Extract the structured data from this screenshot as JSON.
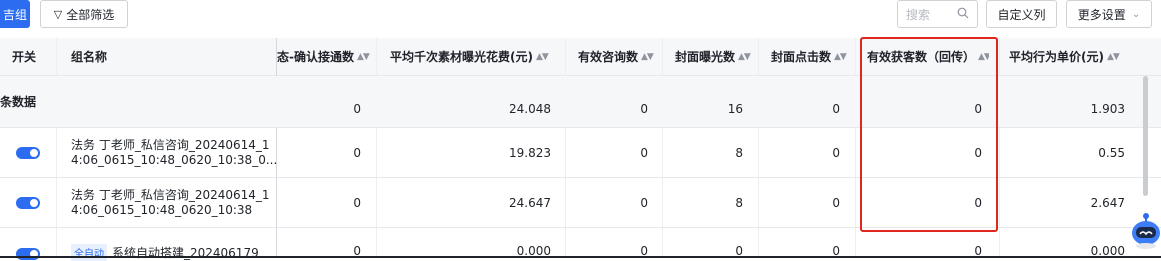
{
  "toolbar": {
    "primary_button_label": "吉组",
    "filter_label": "全部筛选",
    "search_placeholder": "搜索",
    "custom_columns_label": "自定义列",
    "more_settings_label": "更多设置"
  },
  "table": {
    "headers": {
      "switch": "开关",
      "group_name": "组名称",
      "confirmed_calls": "态-确认接通数",
      "cpm_cost": "平均千次素材曝光花费(元)",
      "valid_consult": "有效咨询数",
      "cover_impressions": "封面曝光数",
      "cover_clicks": "封面点击数",
      "valid_leads": "有效获客数（回传）",
      "avg_action_price": "平均行为单价(元)"
    },
    "summary": {
      "label": "条数据",
      "confirmed_calls": "0",
      "cpm_cost": "24.048",
      "valid_consult": "0",
      "cover_impressions": "16",
      "cover_clicks": "0",
      "valid_leads": "0",
      "avg_action_price": "1.903"
    },
    "rows": [
      {
        "name": "法务 丁老师_私信咨询_20240614_14:06_0615_10:48_0620_10:38_0...",
        "name_line1": "法务 丁老师_私信咨询_20240614_1",
        "name_line2": "4:06_0615_10:48_0620_10:38_0...",
        "confirmed_calls": "0",
        "cpm_cost": "19.823",
        "valid_consult": "0",
        "cover_impressions": "8",
        "cover_clicks": "0",
        "valid_leads": "0",
        "avg_action_price": "0.55"
      },
      {
        "name": "法务 丁老师_私信咨询_20240614_14:06_0615_10:48_0620_10:38",
        "name_line1": "法务 丁老师_私信咨询_20240614_1",
        "name_line2": "4:06_0615_10:48_0620_10:38",
        "confirmed_calls": "0",
        "cpm_cost": "24.647",
        "valid_consult": "0",
        "cover_impressions": "8",
        "cover_clicks": "0",
        "valid_leads": "0",
        "avg_action_price": "2.647"
      },
      {
        "tag": "全自动",
        "name_line1": "系统自动搭建_202406179",
        "confirmed_calls": "0",
        "cpm_cost": "0.000",
        "valid_consult": "0",
        "cover_impressions": "0",
        "cover_clicks": "0",
        "valid_leads": "0",
        "avg_action_price": "0.000"
      }
    ]
  },
  "colors": {
    "accent": "#2b6cf0",
    "highlight_border": "#e0271d"
  },
  "icons": [
    "filter-icon",
    "search-icon",
    "chevron-down-icon",
    "sort-icon",
    "assistant-robot-icon"
  ]
}
